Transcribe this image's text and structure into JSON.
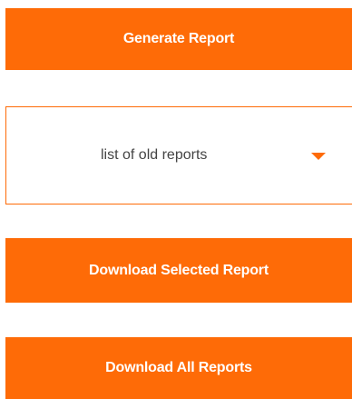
{
  "actions": {
    "generate_label": "Generate Report",
    "download_selected_label": "Download Selected Report",
    "download_all_label": "Download All Reports"
  },
  "reports_select": {
    "selected_value": "list of old reports",
    "icon": "chevron-down-icon"
  },
  "colors": {
    "accent": "#fe6b07",
    "button_text": "#ffffff",
    "select_text": "#444444"
  }
}
